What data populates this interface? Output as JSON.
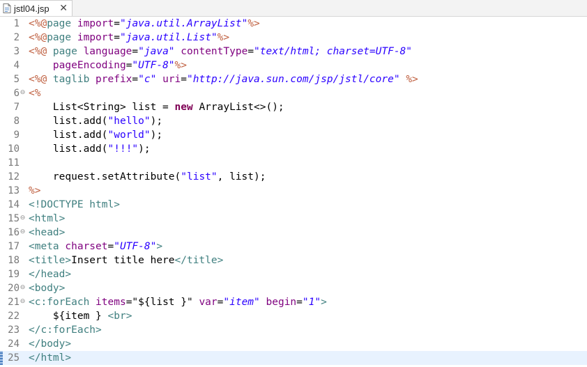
{
  "tab": {
    "title": "jstl04.jsp",
    "close": "✕"
  },
  "lines": [
    {
      "n": "1",
      "fold": "",
      "tokens": [
        [
          "d",
          "<%@"
        ],
        [
          "tag",
          "page "
        ],
        [
          "attr",
          "import"
        ],
        [
          "plain",
          "="
        ],
        [
          "val",
          "\"java.util.ArrayList\""
        ],
        [
          "d",
          "%>"
        ]
      ]
    },
    {
      "n": "2",
      "fold": "",
      "tokens": [
        [
          "d",
          "<%@"
        ],
        [
          "tag",
          "page "
        ],
        [
          "attr",
          "import"
        ],
        [
          "plain",
          "="
        ],
        [
          "val",
          "\"java.util.List\""
        ],
        [
          "d",
          "%>"
        ]
      ]
    },
    {
      "n": "3",
      "fold": "",
      "tokens": [
        [
          "d",
          "<%@ "
        ],
        [
          "tag",
          "page "
        ],
        [
          "attr",
          "language"
        ],
        [
          "plain",
          "="
        ],
        [
          "val",
          "\"java\""
        ],
        [
          "plain",
          " "
        ],
        [
          "attr",
          "contentType"
        ],
        [
          "plain",
          "="
        ],
        [
          "val",
          "\"text/html; charset=UTF-8\""
        ]
      ]
    },
    {
      "n": "4",
      "fold": "",
      "tokens": [
        [
          "plain",
          "    "
        ],
        [
          "attr",
          "pageEncoding"
        ],
        [
          "plain",
          "="
        ],
        [
          "val",
          "\"UTF-8\""
        ],
        [
          "d",
          "%>"
        ]
      ]
    },
    {
      "n": "5",
      "fold": "",
      "tokens": [
        [
          "d",
          "<%@ "
        ],
        [
          "tag",
          "taglib "
        ],
        [
          "attr",
          "prefix"
        ],
        [
          "plain",
          "="
        ],
        [
          "val",
          "\"c\""
        ],
        [
          "plain",
          " "
        ],
        [
          "attr",
          "uri"
        ],
        [
          "plain",
          "="
        ],
        [
          "val",
          "\"http://java.sun.com/jsp/jstl/core\""
        ],
        [
          "plain",
          " "
        ],
        [
          "d",
          "%>"
        ]
      ]
    },
    {
      "n": "6",
      "fold": "⊖",
      "tokens": [
        [
          "d",
          "<%"
        ]
      ]
    },
    {
      "n": "7",
      "fold": "",
      "tokens": [
        [
          "plain",
          "    List<String> list = "
        ],
        [
          "kw",
          "new"
        ],
        [
          "plain",
          " ArrayList<>();"
        ]
      ]
    },
    {
      "n": "8",
      "fold": "",
      "tokens": [
        [
          "plain",
          "    list.add("
        ],
        [
          "str",
          "\"hello\""
        ],
        [
          "plain",
          ");"
        ]
      ]
    },
    {
      "n": "9",
      "fold": "",
      "tokens": [
        [
          "plain",
          "    list.add("
        ],
        [
          "str",
          "\"world\""
        ],
        [
          "plain",
          ");"
        ]
      ]
    },
    {
      "n": "10",
      "fold": "",
      "tokens": [
        [
          "plain",
          "    list.add("
        ],
        [
          "str",
          "\"!!!\""
        ],
        [
          "plain",
          ");"
        ]
      ]
    },
    {
      "n": "11",
      "fold": "",
      "tokens": []
    },
    {
      "n": "12",
      "fold": "",
      "tokens": [
        [
          "plain",
          "    request.setAttribute("
        ],
        [
          "str",
          "\"list\""
        ],
        [
          "plain",
          ", list);"
        ]
      ]
    },
    {
      "n": "13",
      "fold": "",
      "tokens": [
        [
          "d",
          "%>"
        ]
      ]
    },
    {
      "n": "14",
      "fold": "",
      "tokens": [
        [
          "tag",
          "<!DOCTYPE html>"
        ]
      ]
    },
    {
      "n": "15",
      "fold": "⊖",
      "tokens": [
        [
          "tag",
          "<html>"
        ]
      ]
    },
    {
      "n": "16",
      "fold": "⊖",
      "tokens": [
        [
          "tag",
          "<head>"
        ]
      ]
    },
    {
      "n": "17",
      "fold": "",
      "tokens": [
        [
          "tag",
          "<meta "
        ],
        [
          "attr",
          "charset"
        ],
        [
          "plain",
          "="
        ],
        [
          "val",
          "\"UTF-8\""
        ],
        [
          "tag",
          ">"
        ]
      ]
    },
    {
      "n": "18",
      "fold": "",
      "tokens": [
        [
          "tag",
          "<title>"
        ],
        [
          "plain",
          "Insert title here"
        ],
        [
          "tag",
          "</title>"
        ]
      ]
    },
    {
      "n": "19",
      "fold": "",
      "tokens": [
        [
          "tag",
          "</head>"
        ]
      ]
    },
    {
      "n": "20",
      "fold": "⊖",
      "tokens": [
        [
          "tag",
          "<body>"
        ]
      ]
    },
    {
      "n": "21",
      "fold": "⊖",
      "tokens": [
        [
          "tag",
          "<c:forEach "
        ],
        [
          "attr",
          "items"
        ],
        [
          "plain",
          "=\"${list }\" "
        ],
        [
          "attr",
          "var"
        ],
        [
          "plain",
          "="
        ],
        [
          "val",
          "\"item\""
        ],
        [
          "plain",
          " "
        ],
        [
          "attr",
          "begin"
        ],
        [
          "plain",
          "="
        ],
        [
          "val",
          "\"1\""
        ],
        [
          "tag",
          ">"
        ]
      ]
    },
    {
      "n": "22",
      "fold": "",
      "tokens": [
        [
          "plain",
          "    ${item } "
        ],
        [
          "tag",
          "<br>"
        ]
      ]
    },
    {
      "n": "23",
      "fold": "",
      "tokens": [
        [
          "tag",
          "</c:forEach>"
        ]
      ]
    },
    {
      "n": "24",
      "fold": "",
      "tokens": [
        [
          "tag",
          "</body>"
        ]
      ]
    },
    {
      "n": "25",
      "fold": "",
      "tokens": [
        [
          "tag",
          "</html>"
        ]
      ],
      "current": true
    }
  ]
}
